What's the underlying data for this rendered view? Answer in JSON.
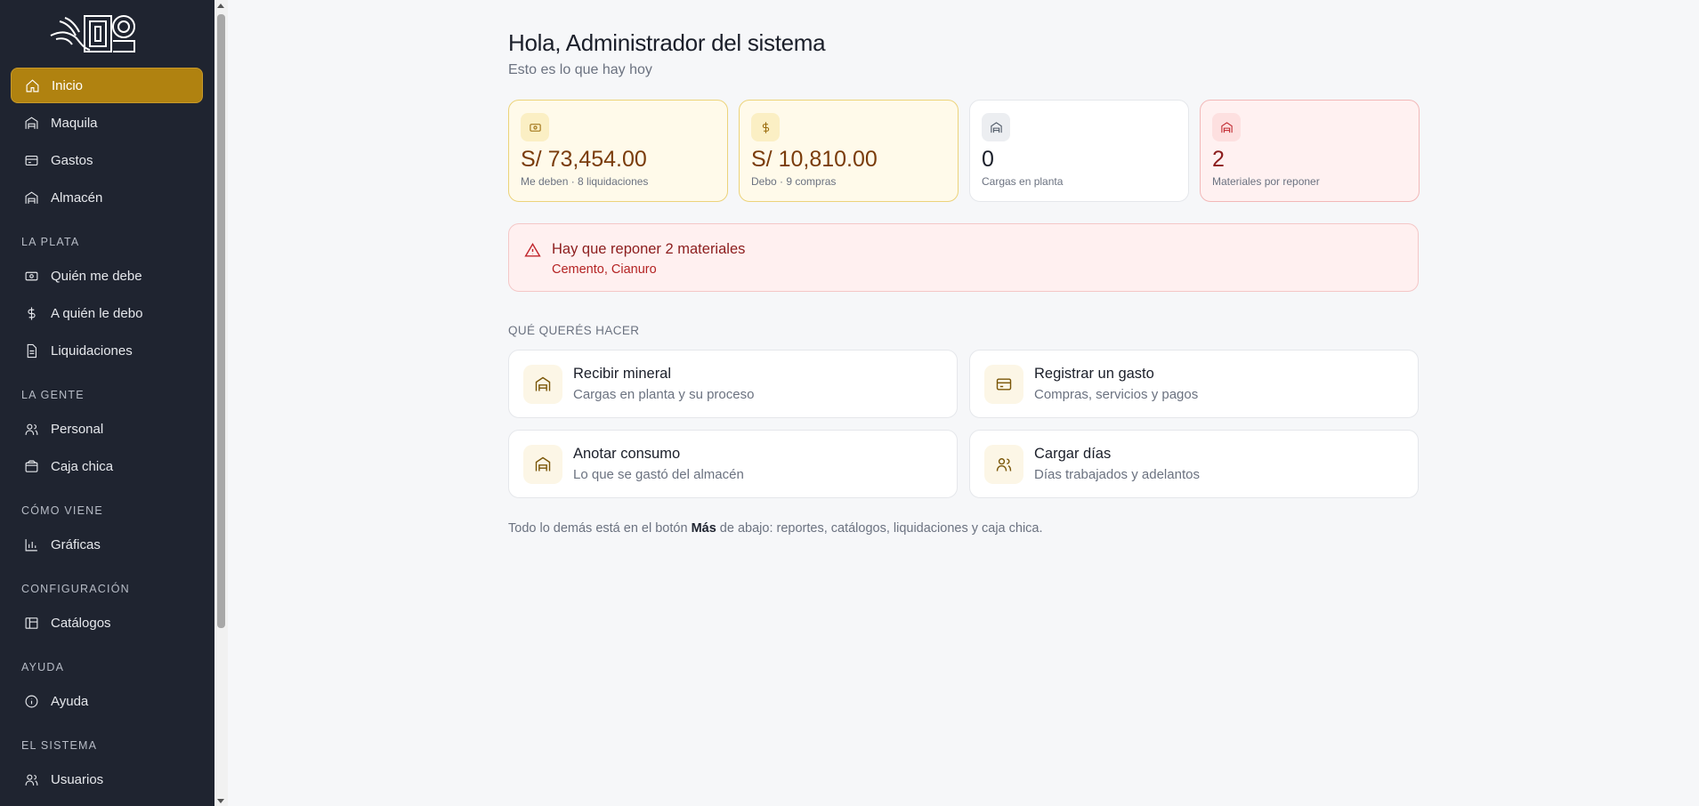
{
  "sidebar": {
    "items": [
      {
        "label": "Inicio",
        "icon": "home-icon",
        "active": true
      },
      {
        "label": "Maquila",
        "icon": "warehouse-icon"
      },
      {
        "label": "Gastos",
        "icon": "card-icon"
      },
      {
        "label": "Almacén",
        "icon": "warehouse-icon"
      }
    ],
    "sections": [
      {
        "title": "LA PLATA",
        "items": [
          {
            "label": "Quién me debe",
            "icon": "money-icon"
          },
          {
            "label": "A quién le debo",
            "icon": "dollar-icon"
          },
          {
            "label": "Liquidaciones",
            "icon": "document-icon"
          }
        ]
      },
      {
        "title": "LA GENTE",
        "items": [
          {
            "label": "Personal",
            "icon": "people-icon"
          },
          {
            "label": "Caja chica",
            "icon": "wallet-icon"
          }
        ]
      },
      {
        "title": "CÓMO VIENE",
        "items": [
          {
            "label": "Gráficas",
            "icon": "bar-chart-icon"
          }
        ]
      },
      {
        "title": "CONFIGURACIÓN",
        "items": [
          {
            "label": "Catálogos",
            "icon": "catalog-icon"
          }
        ]
      },
      {
        "title": "AYUDA",
        "items": [
          {
            "label": "Ayuda",
            "icon": "info-icon"
          }
        ]
      },
      {
        "title": "EL SISTEMA",
        "items": [
          {
            "label": "Usuarios",
            "icon": "users-icon"
          }
        ]
      }
    ]
  },
  "header": {
    "greeting": "Hola, Administrador del sistema",
    "subtitle": "Esto es lo que hay hoy"
  },
  "stats": [
    {
      "value": "S/ 73,454.00",
      "caption": "Me deben · 8 liquidaciones",
      "icon": "money-icon",
      "tone": "yellow"
    },
    {
      "value": "S/ 10,810.00",
      "caption": "Debo · 9 compras",
      "icon": "dollar-icon",
      "tone": "yellow"
    },
    {
      "value": "0",
      "caption": "Cargas en planta",
      "icon": "warehouse-icon",
      "tone": "gray"
    },
    {
      "value": "2",
      "caption": "Materiales por reponer",
      "icon": "warehouse-icon",
      "tone": "red"
    }
  ],
  "alert": {
    "title": "Hay que reponer 2 materiales",
    "text": "Cemento, Cianuro",
    "icon": "warning-icon"
  },
  "actions_title": "QUÉ QUERÉS HACER",
  "actions": [
    {
      "title": "Recibir mineral",
      "subtitle": "Cargas en planta y su proceso",
      "icon": "warehouse-icon"
    },
    {
      "title": "Registrar un gasto",
      "subtitle": "Compras, servicios y pagos",
      "icon": "card-icon"
    },
    {
      "title": "Anotar consumo",
      "subtitle": "Lo que se gastó del almacén",
      "icon": "warehouse-icon"
    },
    {
      "title": "Cargar días",
      "subtitle": "Días trabajados y adelantos",
      "icon": "people-icon"
    }
  ],
  "footer": {
    "before": "Todo lo demás está en el botón ",
    "bold": "Más",
    "after": " de abajo: reportes, catálogos, liquidaciones y caja chica."
  },
  "colors": {
    "sidebar_bg": "#1f2430",
    "accent": "#b08210",
    "alert_red": "#c0262d"
  }
}
